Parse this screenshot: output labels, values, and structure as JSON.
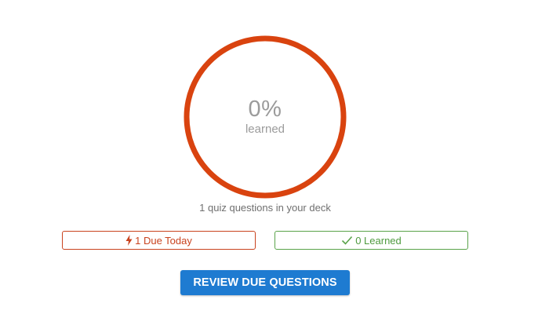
{
  "progress": {
    "percent_label": "0%",
    "caption": "learned",
    "learned_fraction": 0,
    "ring_color": "#d9430f"
  },
  "deck": {
    "count_text": "1 quiz questions in your deck"
  },
  "stats": {
    "due": {
      "icon": "lightning-bolt-icon",
      "label": "1 Due Today",
      "color": "#c9431f"
    },
    "learned": {
      "icon": "checkmark-icon",
      "label": "0 Learned",
      "color": "#5aa34a"
    }
  },
  "actions": {
    "review_label": "REVIEW DUE QUESTIONS",
    "review_color": "#1e7bd1"
  }
}
